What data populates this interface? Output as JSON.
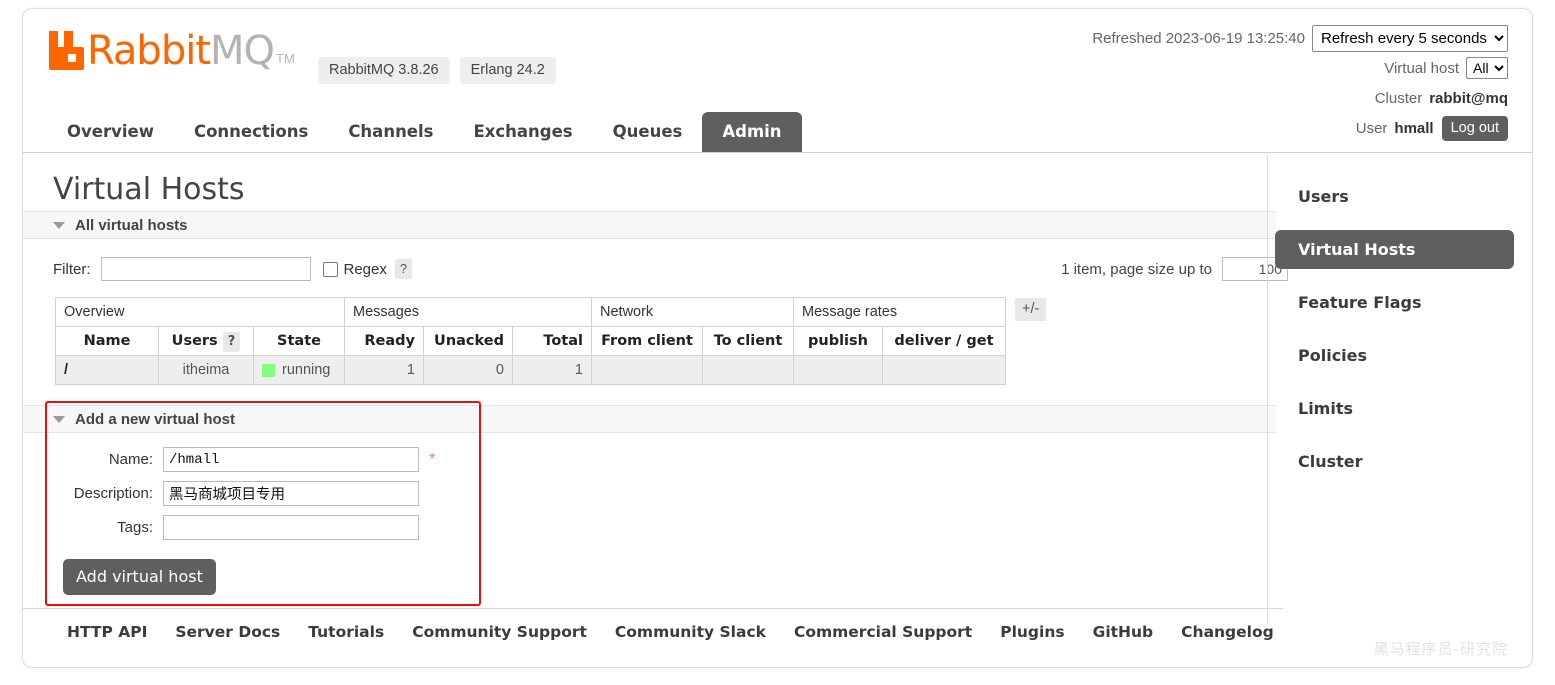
{
  "header": {
    "logo_text_primary": "Rabbit",
    "logo_text_secondary": "MQ",
    "logo_tm": "TM",
    "badges": [
      "RabbitMQ 3.8.26",
      "Erlang 24.2"
    ],
    "refreshed_label": "Refreshed 2023-06-19 13:25:40",
    "refresh_select_value": "Refresh every 5 seconds",
    "refresh_options": [
      "Refresh every 5 seconds"
    ],
    "vhost_label": "Virtual host",
    "vhost_select_value": "All",
    "vhost_options": [
      "All"
    ],
    "cluster_label": "Cluster",
    "cluster_value": "rabbit@mq",
    "user_label": "User",
    "user_value": "hmall",
    "logout_label": "Log out"
  },
  "nav": {
    "tabs": [
      {
        "label": "Overview",
        "active": false
      },
      {
        "label": "Connections",
        "active": false
      },
      {
        "label": "Channels",
        "active": false
      },
      {
        "label": "Exchanges",
        "active": false
      },
      {
        "label": "Queues",
        "active": false
      },
      {
        "label": "Admin",
        "active": true
      }
    ]
  },
  "main": {
    "page_title": "Virtual Hosts",
    "all_vhosts_section_title": "All virtual hosts",
    "filter_label": "Filter:",
    "filter_value": "",
    "filter_placeholder": "",
    "regex_label": "Regex",
    "regex_help": "?",
    "regex_checked": false,
    "pager_text": "1 item, page size up to",
    "page_size_value": "100",
    "plus_minus_label": "+/-"
  },
  "table": {
    "group_headers": [
      {
        "label": "Overview",
        "span": 3
      },
      {
        "label": "Messages",
        "span": 3
      },
      {
        "label": "Network",
        "span": 2
      },
      {
        "label": "Message rates",
        "span": 2
      }
    ],
    "columns": [
      {
        "label": "Name",
        "align": "left"
      },
      {
        "label": "Users",
        "align": "center",
        "help": "?"
      },
      {
        "label": "State",
        "align": "left"
      },
      {
        "label": "Ready",
        "align": "right"
      },
      {
        "label": "Unacked",
        "align": "right"
      },
      {
        "label": "Total",
        "align": "right"
      },
      {
        "label": "From client",
        "align": "left"
      },
      {
        "label": "To client",
        "align": "left"
      },
      {
        "label": "publish",
        "align": "left"
      },
      {
        "label": "deliver / get",
        "align": "left"
      }
    ],
    "rows": [
      {
        "name": "/",
        "users": "itheima",
        "state": "running",
        "state_color": "#80ff80",
        "ready": "1",
        "unacked": "0",
        "total": "1",
        "from_client": "",
        "to_client": "",
        "publish": "",
        "deliver_get": ""
      }
    ]
  },
  "add_form": {
    "section_title": "Add a new virtual host",
    "name_label": "Name:",
    "name_value": "/hmall",
    "name_required_mark": "*",
    "description_label": "Description:",
    "description_value": "黑马商城项目专用",
    "tags_label": "Tags:",
    "tags_value": "",
    "submit_label": "Add virtual host",
    "highlight_color": "#e81010"
  },
  "sidebar": {
    "items": [
      {
        "label": "Users",
        "active": false
      },
      {
        "label": "Virtual Hosts",
        "active": true
      },
      {
        "label": "Feature Flags",
        "active": false
      },
      {
        "label": "Policies",
        "active": false
      },
      {
        "label": "Limits",
        "active": false
      },
      {
        "label": "Cluster",
        "active": false
      }
    ]
  },
  "footer": {
    "links": [
      "HTTP API",
      "Server Docs",
      "Tutorials",
      "Community Support",
      "Community Slack",
      "Commercial Support",
      "Plugins",
      "GitHub",
      "Changelog"
    ]
  },
  "watermark": "黑马程序员-研究院"
}
